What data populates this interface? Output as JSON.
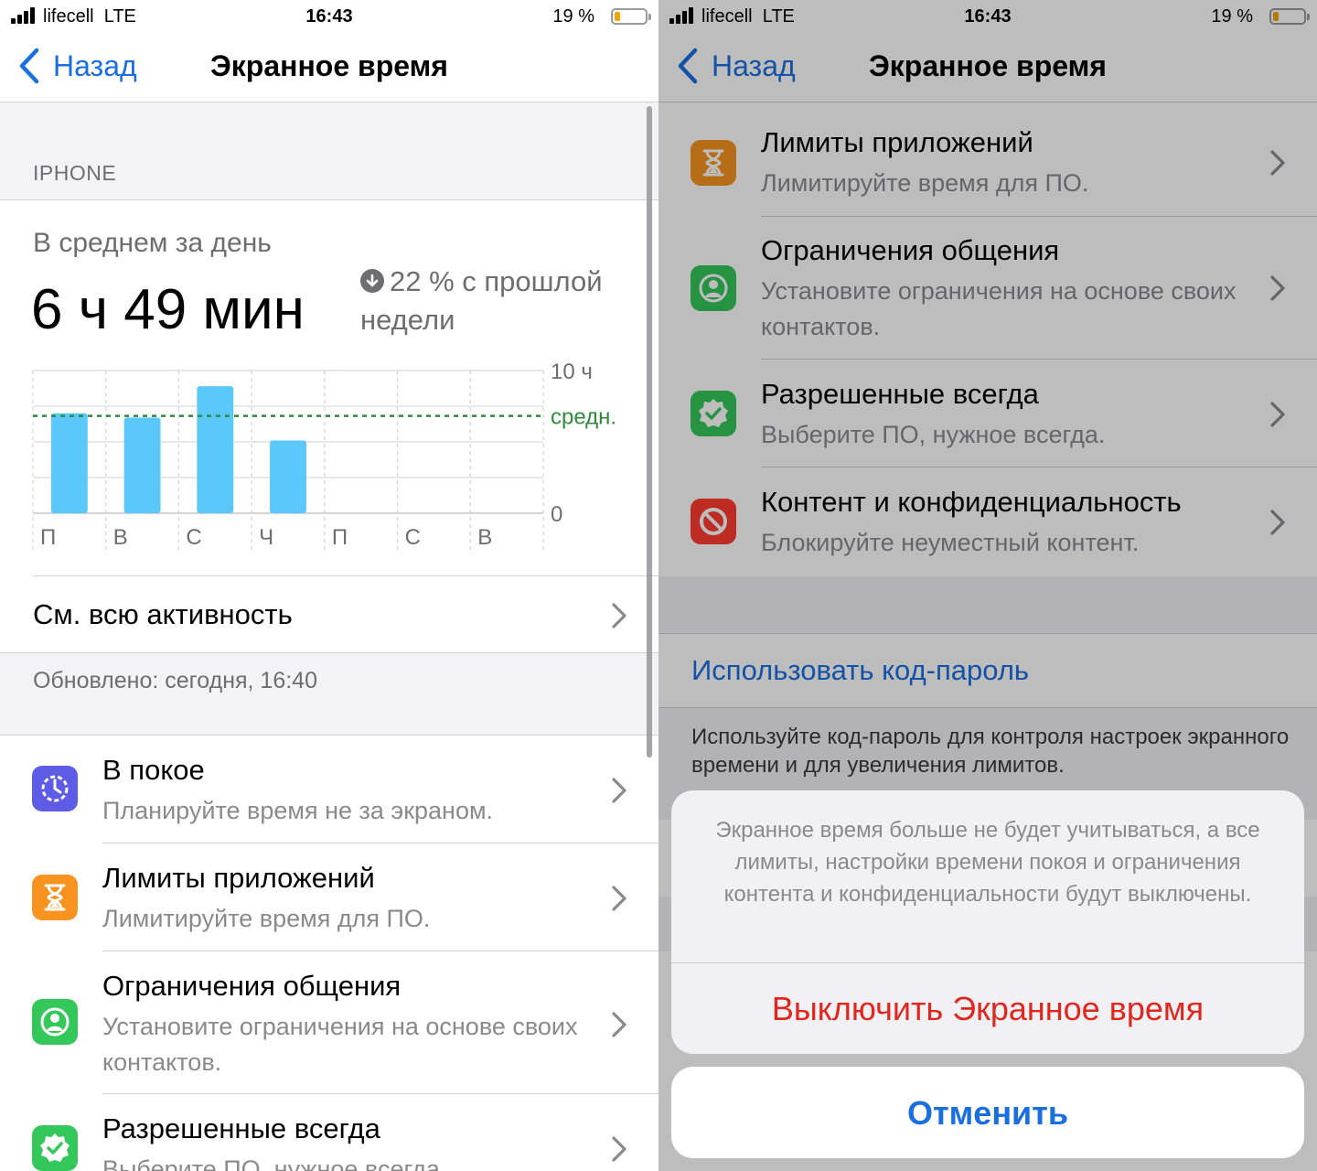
{
  "status": {
    "carrier": "lifecell",
    "network": "LTE",
    "time": "16:43",
    "battery": "19 %",
    "battery_level": 0.19
  },
  "nav": {
    "back_label": "Назад",
    "title": "Экранное время"
  },
  "summary": {
    "section": "IPHONE",
    "avg_label": "В среднем за день",
    "avg_value": "6 ч 49 мин",
    "delta_text": "22 % с прошлой недели",
    "see_all": "См. всю активность",
    "updated": "Обновлено: сегодня, 16:40"
  },
  "chart_data": {
    "type": "bar",
    "categories": [
      "П",
      "В",
      "С",
      "Ч",
      "П",
      "С",
      "В"
    ],
    "values": [
      7.0,
      6.7,
      8.9,
      5.1,
      0,
      0,
      0
    ],
    "ylim": [
      0,
      10
    ],
    "average": 6.82,
    "y_tick_labels": [
      "10 ч",
      "0"
    ],
    "average_label": "средн.",
    "colors": {
      "bar": "#5ac8fa",
      "average": "#2f8a3c"
    }
  },
  "items": [
    {
      "title": "В покое",
      "subtitle": "Планируйте время не за экраном.",
      "icon": "downtime-icon",
      "color": "#5e5ce6"
    },
    {
      "title": "Лимиты приложений",
      "subtitle": "Лимитируйте время для ПО.",
      "icon": "hourglass-icon",
      "color": "#f7931e"
    },
    {
      "title": "Ограничения общения",
      "subtitle": "Установите ограничения на основе своих контактов.",
      "icon": "contact-icon",
      "color": "#34c759"
    },
    {
      "title": "Разрешенные всегда",
      "subtitle": "Выберите ПО, нужное всегда.",
      "icon": "checkmark-badge-icon",
      "color": "#34c759"
    },
    {
      "title": "Контент и конфиденциальность",
      "subtitle": "Блокируйте неуместный контент.",
      "icon": "restriction-icon",
      "color": "#ff3b30"
    }
  ],
  "passcode": {
    "label": "Использовать код-пароль",
    "footnote": "Используйте код-пароль для контроля настроек экранного времени и для увеличения лимитов."
  },
  "sheet": {
    "message": "Экранное время больше не будет учитываться, а все лимиты, настройки времени покоя и ограничения контента и конфиденциальности будут выключены.",
    "destructive": "Выключить Экранное время",
    "cancel": "Отменить"
  }
}
